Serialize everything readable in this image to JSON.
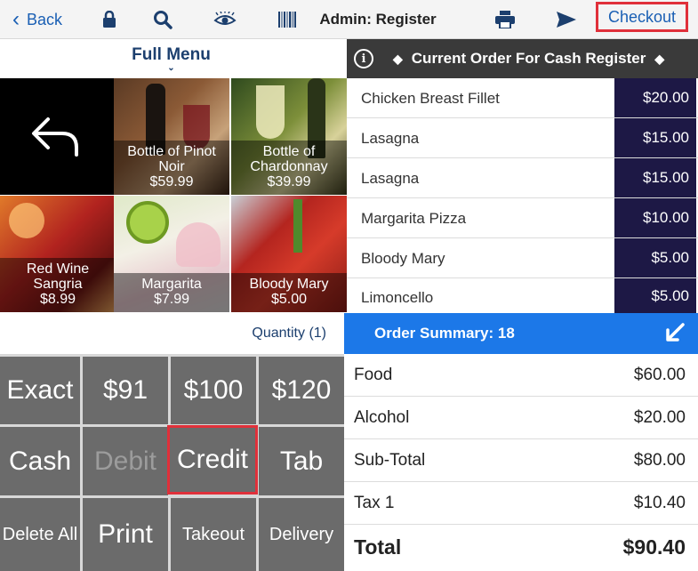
{
  "topbar": {
    "back_label": "Back",
    "title": "Admin: Register",
    "checkout_label": "Checkout",
    "icons": [
      "lock-icon",
      "search-icon",
      "eye-icon",
      "barcode-icon",
      "print-icon",
      "send-icon"
    ]
  },
  "menu": {
    "title": "Full Menu",
    "back_tile_icon": "undo-icon",
    "items": [
      {
        "name": "Bottle of Pinot Noir",
        "price": "$59.99"
      },
      {
        "name": "Bottle of Chardonnay",
        "price": "$39.99"
      },
      {
        "name": "Red Wine Sangria",
        "price": "$8.99"
      },
      {
        "name": "Margarita",
        "price": "$7.99"
      },
      {
        "name": "Bloody Mary",
        "price": "$5.00"
      }
    ],
    "quantity_label": "Quantity (1)"
  },
  "keypad": {
    "keys": [
      "Exact",
      "$91",
      "$100",
      "$120",
      "Cash",
      "Debit",
      "Credit",
      "Tab",
      "Delete All",
      "Print",
      "Takeout",
      "Delivery"
    ]
  },
  "order": {
    "header": "Current Order For Cash Register",
    "items": [
      {
        "name": "Chicken Breast Fillet",
        "price": "$20.00"
      },
      {
        "name": "Lasagna",
        "price": "$15.00"
      },
      {
        "name": "Lasagna",
        "price": "$15.00"
      },
      {
        "name": "Margarita Pizza",
        "price": "$10.00"
      },
      {
        "name": "Bloody Mary",
        "price": "$5.00"
      },
      {
        "name": "Limoncello",
        "price": "$5.00"
      }
    ],
    "summary_label": "Order Summary: 18"
  },
  "totals": [
    {
      "label": "Food",
      "value": "$60.00"
    },
    {
      "label": "Alcohol",
      "value": "$20.00"
    },
    {
      "label": "Sub-Total",
      "value": "$80.00"
    },
    {
      "label": "Tax 1",
      "value": "$10.40"
    },
    {
      "label": "Total",
      "value": "$90.40"
    }
  ],
  "colors": {
    "accent": "#1c78e8",
    "link": "#1a5fb4",
    "highlight": "#e0303a",
    "price_bg": "#1d1845",
    "key_bg": "#6b6b6b"
  }
}
